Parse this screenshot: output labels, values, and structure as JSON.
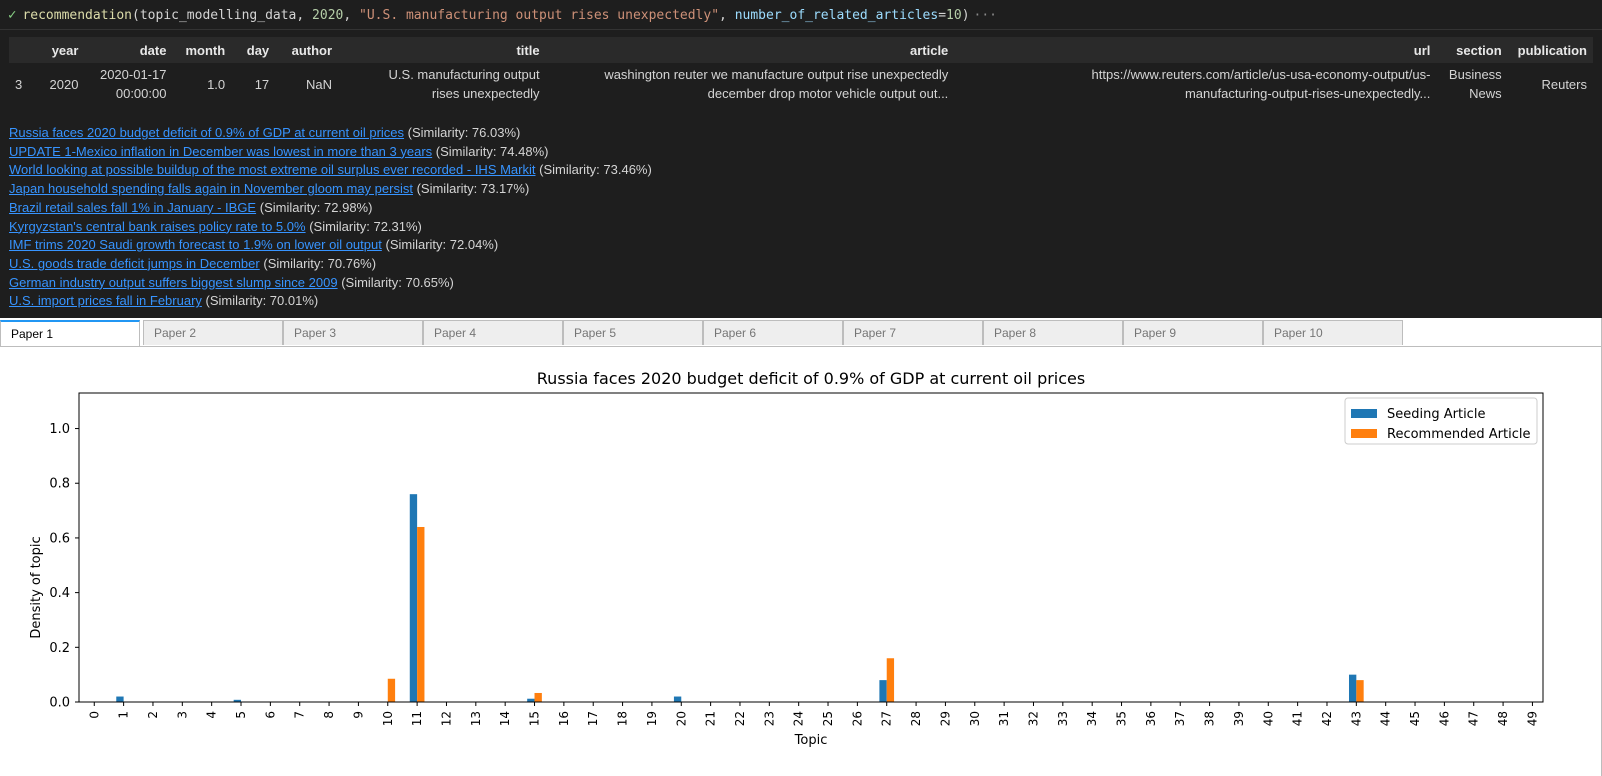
{
  "cell": {
    "status_icon": "check-icon",
    "fn": "recommendation",
    "open": "(",
    "arg1": "topic_modelling_data",
    "comma": ", ",
    "arg2": "2020",
    "arg3": "\"U.S. manufacturing output rises unexpectedly\"",
    "kwarg_name": "number_of_related_articles",
    "eq": "=",
    "kwarg_value": "10",
    "close": ")",
    "ellipsis": "···"
  },
  "dataframe": {
    "columns": [
      "",
      "year",
      "date",
      "month",
      "day",
      "author",
      "title",
      "article",
      "url",
      "section",
      "publication"
    ],
    "rows": [
      {
        "index": "3",
        "year": "2020",
        "date_line1": "2020-01-17",
        "date_line2": "00:00:00",
        "month": "1.0",
        "day": "17",
        "author": "NaN",
        "title_line1": "U.S. manufacturing output",
        "title_line2": "rises unexpectedly",
        "article_line1": "washington reuter we manufacture output rise unexpectedly",
        "article_line2": "december drop motor vehicle output out...",
        "url_line1": "https://www.reuters.com/article/us-usa-economy-output/us-",
        "url_line2": "manufacturing-output-rises-unexpectedly...",
        "section_line1": "Business",
        "section_line2": "News",
        "publication": "Reuters"
      }
    ]
  },
  "related_articles": [
    {
      "title": "Russia faces 2020 budget deficit of 0.9% of GDP at current oil prices",
      "similarity": "(Similarity: 76.03%)"
    },
    {
      "title": "UPDATE 1-Mexico inflation in December was lowest in more than 3 years",
      "similarity": "(Similarity: 74.48%)"
    },
    {
      "title": "World looking at possible buildup of the most extreme oil surplus ever recorded - IHS Markit",
      "similarity": "(Similarity: 73.46%)"
    },
    {
      "title": "Japan household spending falls again in November gloom may persist",
      "similarity": "(Similarity: 73.17%)"
    },
    {
      "title": "Brazil retail sales fall 1% in January - IBGE",
      "similarity": "(Similarity: 72.98%)"
    },
    {
      "title": "Kyrgyzstan's central bank raises policy rate to 5.0%",
      "similarity": "(Similarity: 72.31%)"
    },
    {
      "title": "IMF trims 2020 Saudi growth forecast to 1.9% on lower oil output",
      "similarity": "(Similarity: 72.04%)"
    },
    {
      "title": "U.S. goods trade deficit jumps in December",
      "similarity": "(Similarity: 70.76%)"
    },
    {
      "title": "German industry output suffers biggest slump since 2009",
      "similarity": "(Similarity: 70.65%)"
    },
    {
      "title": "U.S. import prices fall in February",
      "similarity": "(Similarity: 70.01%)"
    }
  ],
  "tabs": [
    "Paper 1",
    "Paper 2",
    "Paper 3",
    "Paper 4",
    "Paper 5",
    "Paper 6",
    "Paper 7",
    "Paper 8",
    "Paper 9",
    "Paper 10"
  ],
  "active_tab": 0,
  "chart_data": {
    "type": "bar",
    "title": "Russia faces 2020 budget deficit of 0.9% of GDP at current oil prices",
    "xlabel": "Topic",
    "ylabel": "Density of topic",
    "ylim": [
      0,
      1.13
    ],
    "yticks": [
      "0.0",
      "0.2",
      "0.4",
      "0.6",
      "0.8",
      "1.0"
    ],
    "ytick_values": [
      0,
      0.2,
      0.4,
      0.6,
      0.8,
      1.0
    ],
    "legend_position": "top-right",
    "grid": false,
    "categories": [
      "0",
      "1",
      "2",
      "3",
      "4",
      "5",
      "6",
      "7",
      "8",
      "9",
      "10",
      "11",
      "12",
      "13",
      "14",
      "15",
      "16",
      "17",
      "18",
      "19",
      "20",
      "21",
      "22",
      "23",
      "24",
      "25",
      "26",
      "27",
      "28",
      "29",
      "30",
      "31",
      "32",
      "33",
      "34",
      "35",
      "36",
      "37",
      "38",
      "39",
      "40",
      "41",
      "42",
      "43",
      "44",
      "45",
      "46",
      "47",
      "48",
      "49"
    ],
    "series": [
      {
        "name": "Seeding Article",
        "color": "#1f77b4",
        "values": [
          0,
          0.02,
          0,
          0,
          0,
          0.008,
          0,
          0,
          0,
          0,
          0,
          0.76,
          0,
          0,
          0,
          0.012,
          0,
          0,
          0,
          0,
          0.02,
          0,
          0,
          0,
          0,
          0,
          0,
          0.08,
          0,
          0,
          0,
          0,
          0,
          0,
          0,
          0,
          0,
          0,
          0,
          0,
          0,
          0,
          0,
          0.1,
          0,
          0,
          0,
          0,
          0,
          0
        ]
      },
      {
        "name": "Recommended Article",
        "color": "#ff7f0e",
        "values": [
          0,
          0,
          0,
          0,
          0,
          0,
          0,
          0,
          0,
          0,
          0.085,
          0.64,
          0,
          0,
          0,
          0.033,
          0,
          0,
          0,
          0,
          0,
          0,
          0,
          0,
          0,
          0,
          0,
          0.16,
          0,
          0,
          0,
          0,
          0,
          0,
          0,
          0,
          0,
          0,
          0,
          0,
          0,
          0,
          0,
          0.08,
          0,
          0,
          0,
          0,
          0,
          0
        ]
      }
    ]
  }
}
